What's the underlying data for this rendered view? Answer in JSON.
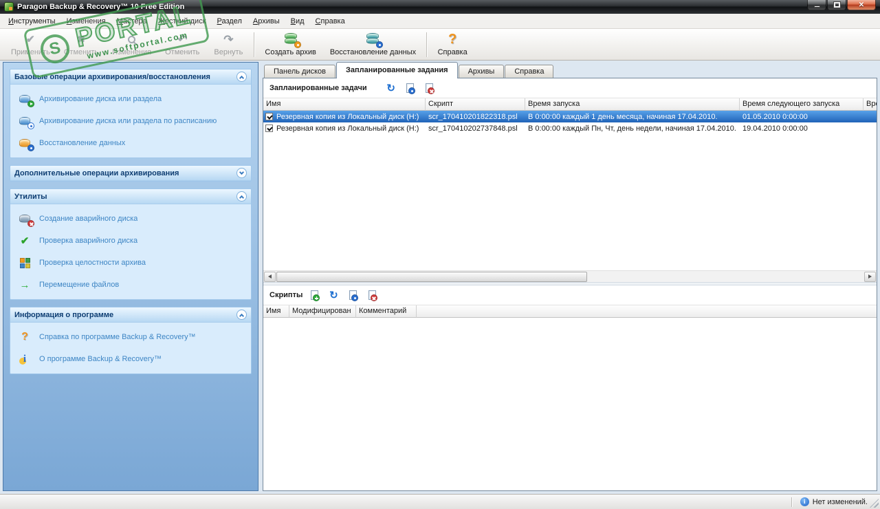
{
  "window": {
    "title": "Paragon Backup & Recovery™ 10 Free Edition"
  },
  "menu": {
    "items": [
      "Инструменты",
      "Изменения",
      "Мастера",
      "Жесткий диск",
      "Раздел",
      "Архивы",
      "Вид",
      "Справка"
    ]
  },
  "toolbar": {
    "apply": "Применить",
    "discard": "Отменить",
    "changes": "Изменения",
    "undo": "Отменить",
    "redo": "Вернуть",
    "create_archive": "Создать архив",
    "restore_data": "Восстановление данных",
    "help": "Справка"
  },
  "watermark": {
    "text": "PORTAL",
    "url": "www.softportal.com"
  },
  "sidebar": {
    "sections": [
      {
        "title": "Базовые операции архивирования/восстановления",
        "items": [
          "Архивирование диска или раздела",
          "Архивирование диска или раздела по расписанию",
          "Восстановление данных"
        ]
      },
      {
        "title": "Дополнительные операции архивирования",
        "items": []
      },
      {
        "title": "Утилиты",
        "items": [
          "Создание аварийного диска",
          "Проверка аварийного диска",
          "Проверка целостности архива",
          "Перемещение файлов"
        ]
      },
      {
        "title": "Информация о программе",
        "items": [
          "Справка по программе Backup & Recovery™",
          "О программе Backup & Recovery™"
        ]
      }
    ]
  },
  "tabs": {
    "items": [
      "Панель дисков",
      "Запланированные задания",
      "Архивы",
      "Справка"
    ],
    "active": "Запланированные задания"
  },
  "tasks": {
    "title": "Запланированные задачи",
    "columns": [
      "Имя",
      "Скрипт",
      "Время запуска",
      "Время следующего запуска",
      "Врем"
    ],
    "rows": [
      {
        "name": "Резервная копия из Локальный диск (H:)",
        "script": "scr_170410201822318.psl",
        "start_time": "В 0:00:00 каждый 1 день месяца, начиная 17.04.2010.",
        "next_run": "01.05.2010 0:00:00"
      },
      {
        "name": "Резервная копия из Локальный диск (H:)",
        "script": "scr_170410202737848.psl",
        "start_time": "В 0:00:00 каждый Пн, Чт,  день недели, начиная 17.04.2010.",
        "next_run": "19.04.2010 0:00:00"
      }
    ]
  },
  "scripts": {
    "title": "Скрипты",
    "columns": [
      "Имя",
      "Модифицирован",
      "Комментарий"
    ]
  },
  "statusbar": {
    "message": "Нет изменений."
  },
  "icons": {
    "apply": "✔",
    "discard": "✖",
    "undo": "↶",
    "redo": "↷",
    "refresh": "↻",
    "check": "✔",
    "arrow": "→",
    "question": "?",
    "info": "i",
    "close": "✕",
    "logo": "S"
  }
}
